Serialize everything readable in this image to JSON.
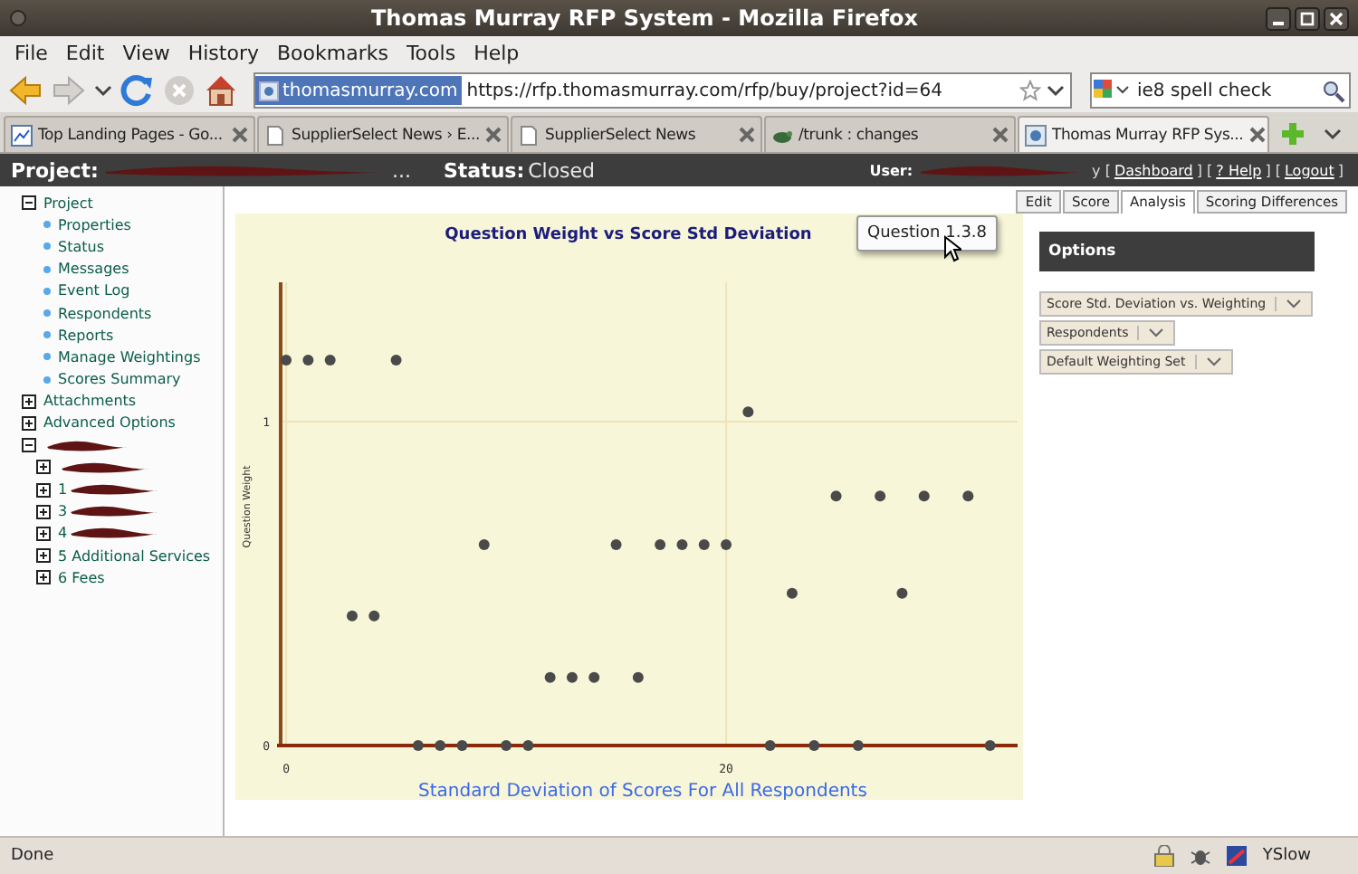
{
  "window": {
    "title": "Thomas Murray RFP System - Mozilla Firefox"
  },
  "menu": [
    "File",
    "Edit",
    "View",
    "History",
    "Bookmarks",
    "Tools",
    "Help"
  ],
  "navigation": {
    "site_identity": "thomasmurray.com",
    "url": "https://rfp.thomasmurray.com/rfp/buy/project?id=64",
    "search": "ie8 spell check"
  },
  "browser_tabs": [
    {
      "title": "Top Landing Pages - Go...",
      "kind": "chart",
      "selected": false
    },
    {
      "title": "SupplierSelect News › E...",
      "kind": "page",
      "selected": false
    },
    {
      "title": "SupplierSelect News",
      "kind": "page",
      "selected": false
    },
    {
      "title": "/trunk : changes",
      "kind": "repository",
      "selected": false
    },
    {
      "title": "Thomas Murray RFP Sys...",
      "kind": "site",
      "selected": true
    }
  ],
  "app_header": {
    "project_label": "Project:",
    "project_tail": "...",
    "status_label": "Status:",
    "status": "Closed",
    "user_label": "User:",
    "user_links": [
      {
        "kind": "text",
        "text": "y ["
      },
      {
        "kind": "link",
        "text": "Dashboard"
      },
      {
        "kind": "text",
        "text": "] ["
      },
      {
        "kind": "link",
        "text": "? Help"
      },
      {
        "kind": "text",
        "text": "] ["
      },
      {
        "kind": "link",
        "text": "Logout"
      },
      {
        "kind": "text",
        "text": "]"
      }
    ]
  },
  "sidebar": {
    "tree": [
      {
        "kind": "folder",
        "label": "Project",
        "expanded": true,
        "children": [
          {
            "kind": "page",
            "label": "Properties"
          },
          {
            "kind": "page",
            "label": "Status"
          },
          {
            "kind": "page",
            "label": "Messages"
          },
          {
            "kind": "page",
            "label": "Event Log"
          },
          {
            "kind": "page",
            "label": "Respondents"
          },
          {
            "kind": "page",
            "label": "Reports"
          },
          {
            "kind": "page",
            "label": "Manage Weightings"
          },
          {
            "kind": "page",
            "label": "Scores Summary"
          }
        ]
      },
      {
        "kind": "folder",
        "label": "Attachments",
        "expanded": false
      },
      {
        "kind": "folder",
        "label": "Advanced Options",
        "expanded": false
      },
      {
        "kind": "folder",
        "redacted": true,
        "expanded": true,
        "children": [
          {
            "kind": "folder",
            "redacted": true,
            "expanded": false
          },
          {
            "kind": "folder",
            "label": "1",
            "redacted": true,
            "expanded": false
          },
          {
            "kind": "folder",
            "label": "3",
            "redacted": true,
            "expanded": false
          },
          {
            "kind": "folder",
            "label": "4",
            "redacted": true,
            "expanded": false
          },
          {
            "kind": "folder",
            "label": "5 Additional Services",
            "expanded": false
          },
          {
            "kind": "folder",
            "label": "6 Fees",
            "expanded": false
          }
        ]
      }
    ]
  },
  "content_tabs": [
    {
      "label": "Edit",
      "selected": false
    },
    {
      "label": "Score",
      "selected": false
    },
    {
      "label": "Analysis",
      "selected": true
    },
    {
      "label": "Scoring Differences",
      "selected": false
    }
  ],
  "chart": {
    "tooltip": "Question 1.3.8",
    "chart_data": {
      "type": "scatter",
      "title": "Question Weight vs Score Std Deviation",
      "xlabel": "Standard Deviation of Scores For All Respondents",
      "ylabel": "Question Weight",
      "xlim": [
        -0.25,
        33.25
      ],
      "ylim": [
        0,
        1.43
      ],
      "xticks": [
        0,
        20
      ],
      "yticks": [
        0,
        1
      ],
      "grid": true,
      "x": [
        0,
        1,
        2,
        5,
        3,
        4,
        6,
        7,
        8,
        10,
        11,
        9,
        12,
        13,
        14,
        16,
        15,
        17,
        18,
        19,
        20,
        21,
        22,
        24,
        26,
        32,
        23,
        25,
        27,
        29,
        31,
        28
      ],
      "series": [
        {
          "color": "#4a4a4a",
          "values": [
            1.19,
            1.19,
            1.19,
            1.19,
            0.4,
            0.4,
            0,
            0,
            0,
            0,
            0,
            0.62,
            0.21,
            0.21,
            0.21,
            0.21,
            0.62,
            0.62,
            0.62,
            0.62,
            0.62,
            1.03,
            0,
            0,
            0,
            0,
            0.47,
            0.77,
            0.77,
            0.77,
            0.77,
            0.47
          ]
        }
      ]
    }
  },
  "options": {
    "title": "Options",
    "dropdowns": [
      "Score Std. Deviation vs. Weighting",
      "Respondents",
      "Default Weighting Set"
    ]
  },
  "status_bar": {
    "text": "Done",
    "addon": "YSlow"
  }
}
